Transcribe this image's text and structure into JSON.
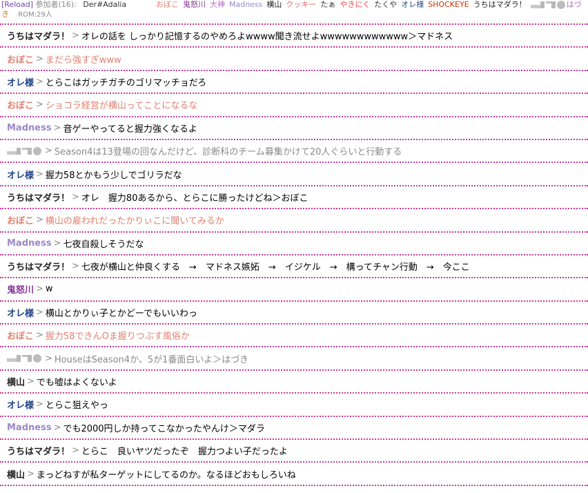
{
  "header": {
    "reload": "[Reload]",
    "participants": "参加者(16):",
    "user": "Der#Adalia",
    "rom_prefix": "き",
    "rom": "ROM:29人"
  },
  "userlist": [
    {
      "name": "おぼこ",
      "color": "#e08070"
    },
    {
      "name": "鬼怒川",
      "color": "#883399"
    },
    {
      "name": "大神",
      "color": "#bb66cc"
    },
    {
      "name": "Madness",
      "color": "#9988cc"
    },
    {
      "name": "横山",
      "color": "#222222"
    },
    {
      "name": "クッキー",
      "color": "#ee6666"
    },
    {
      "name": "たぁ",
      "color": "#333333"
    },
    {
      "name": "やきにく",
      "color": "#ff4444"
    },
    {
      "name": "たくや",
      "color": "#333333"
    },
    {
      "name": "オレ様",
      "color": "#224488"
    },
    {
      "name": "SHOCKEYE",
      "color": "#cc3300"
    },
    {
      "name": "うちはマダラ！",
      "color": "#222222"
    },
    {
      "name": "はづ",
      "color": "#bb66cc"
    }
  ],
  "messages": [
    {
      "name": "うちはマダラ！",
      "name_color": "#222222",
      "text": "オレの話を しっかり記憶するのやめろよwwww聞き流せよwwwwwwwwwwww＞マドネス",
      "text_color": "#000000"
    },
    {
      "name": "おぼこ",
      "name_color": "#e08070",
      "text": "まだら強すぎwww",
      "text_color": "#e08070"
    },
    {
      "name": "オレ様",
      "name_color": "#224488",
      "text": "とらこはガッチガチのゴリマッチョだろ",
      "text_color": "#000000"
    },
    {
      "name": "おぼこ",
      "name_color": "#e08070",
      "text": "ショコラ経営が横山ってことになるな",
      "text_color": "#e08070"
    },
    {
      "name": "Madness",
      "name_color": "#9988cc",
      "text": "音ゲーやってると握力強くなるよ",
      "text_color": "#000000"
    },
    {
      "name": "",
      "avatar": true,
      "text": "Season4は13登場の回なんだけど、診断科のチーム募集かけて20人ぐらいと行動する",
      "text_color": "#888888"
    },
    {
      "name": "オレ様",
      "name_color": "#224488",
      "text": "握力58とかもう少しでゴリラだな",
      "text_color": "#000000"
    },
    {
      "name": "うちはマダラ！",
      "name_color": "#222222",
      "text": "オレ　握力80あるから、とらこに勝ったけどね＞おぼこ",
      "text_color": "#000000"
    },
    {
      "name": "おぼこ",
      "name_color": "#e08070",
      "text": "横山の雇われだったかりぃこに聞いてみるか",
      "text_color": "#e08070"
    },
    {
      "name": "Madness",
      "name_color": "#9988cc",
      "text": "七夜自殺しそうだな",
      "text_color": "#000000"
    },
    {
      "name": "うちはマダラ！",
      "name_color": "#222222",
      "text": "七夜が横山と仲良くする　→　マドネス嫉妬　→　イジケル　→　構ってチャン行動　→　今ここ",
      "text_color": "#000000"
    },
    {
      "name": "鬼怒川",
      "name_color": "#883399",
      "text": "w",
      "text_color": "#000000"
    },
    {
      "name": "オレ様",
      "name_color": "#224488",
      "text": "横山とかりぃ子とかどーでもいいわっ",
      "text_color": "#000000"
    },
    {
      "name": "おぼこ",
      "name_color": "#e08070",
      "text": "握力58できんOま握りつぶす風俗か",
      "text_color": "#e08070"
    },
    {
      "name": "",
      "avatar": true,
      "text": "HouseはSeason4か、5が1番面白いよ＞はづき",
      "text_color": "#888888"
    },
    {
      "name": "横山",
      "name_color": "#222222",
      "text": "でも嘘はよくないよ",
      "text_color": "#000000"
    },
    {
      "name": "オレ様",
      "name_color": "#224488",
      "text": "とらこ狙えやっ",
      "text_color": "#000000"
    },
    {
      "name": "Madness",
      "name_color": "#9988cc",
      "text": "でも2000円しか持ってこなかったやんけ＞マダラ",
      "text_color": "#000000"
    },
    {
      "name": "うちはマダラ！",
      "name_color": "#222222",
      "text": "とらこ　良いヤツだったぞ　握力つよい子だったよ",
      "text_color": "#000000"
    },
    {
      "name": "横山",
      "name_color": "#222222",
      "text": "まっどねすが私ターゲットにしてるのか。なるほどおもしろいね",
      "text_color": "#000000"
    }
  ]
}
